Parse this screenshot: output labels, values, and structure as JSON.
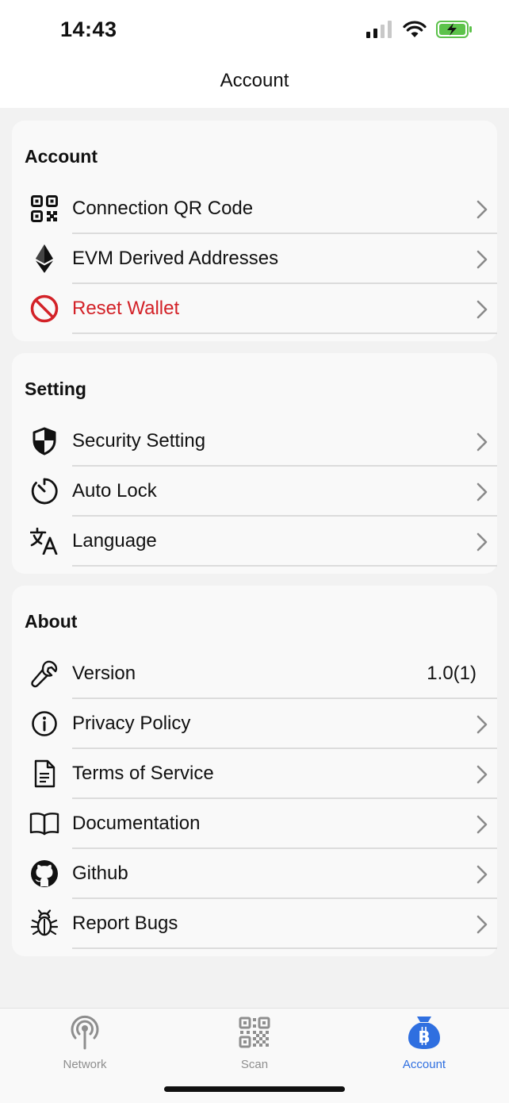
{
  "status_bar": {
    "time": "14:43"
  },
  "nav": {
    "title": "Account"
  },
  "sections": {
    "account": {
      "title": "Account",
      "items": [
        {
          "label": "Connection QR Code",
          "icon": "qr-code-icon"
        },
        {
          "label": "EVM Derived Addresses",
          "icon": "ethereum-icon"
        },
        {
          "label": "Reset Wallet",
          "icon": "prohibited-icon",
          "color": "#d32228"
        }
      ]
    },
    "setting": {
      "title": "Setting",
      "items": [
        {
          "label": "Security Setting",
          "icon": "shield-icon"
        },
        {
          "label": "Auto Lock",
          "icon": "timer-icon"
        },
        {
          "label": "Language",
          "icon": "translate-icon"
        }
      ]
    },
    "about": {
      "title": "About",
      "items": [
        {
          "label": "Version",
          "icon": "wrench-icon",
          "value": "1.0(1)"
        },
        {
          "label": "Privacy Policy",
          "icon": "info-icon"
        },
        {
          "label": "Terms of Service",
          "icon": "document-icon"
        },
        {
          "label": "Documentation",
          "icon": "book-icon"
        },
        {
          "label": "Github",
          "icon": "github-icon"
        },
        {
          "label": "Report Bugs",
          "icon": "bug-icon"
        }
      ]
    }
  },
  "tab_bar": {
    "tabs": [
      {
        "label": "Network",
        "icon": "antenna-icon",
        "active": false
      },
      {
        "label": "Scan",
        "icon": "qr-scan-icon",
        "active": false
      },
      {
        "label": "Account",
        "icon": "bitcoin-bag-icon",
        "active": true
      }
    ]
  },
  "colors": {
    "accent": "#2f6fe0",
    "danger": "#d32228",
    "background": "#f2f2f2",
    "card": "#f9f9f9"
  }
}
